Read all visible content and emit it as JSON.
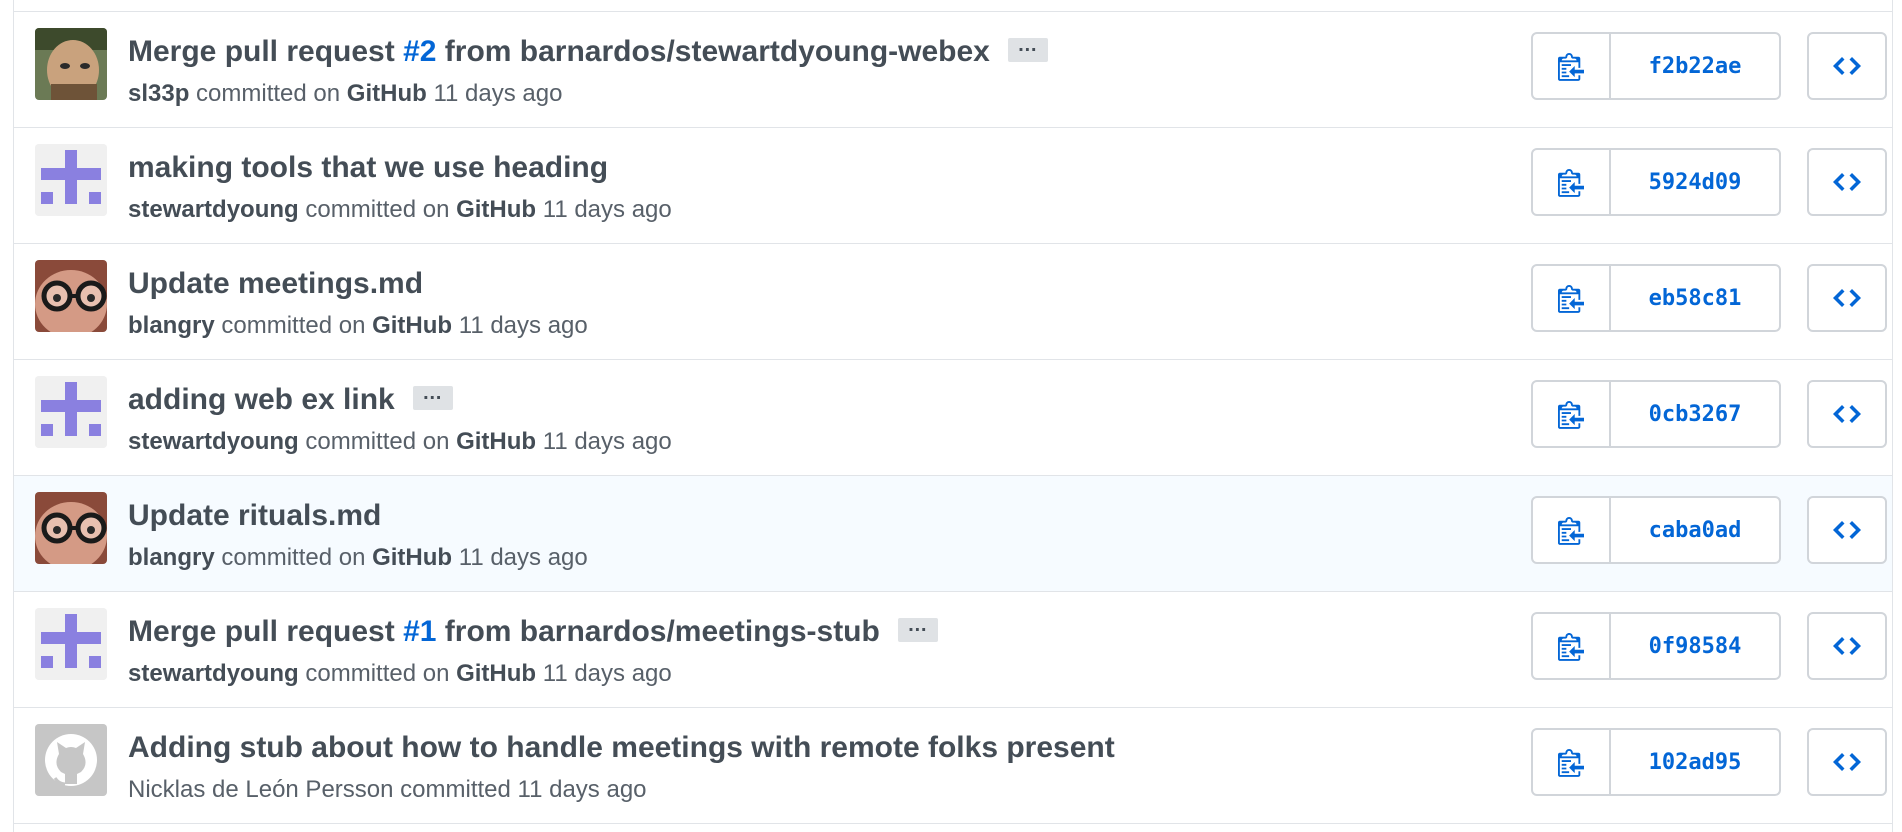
{
  "commits": [
    {
      "avatar": "photo-avatar-bearded-man",
      "title_prefix": "Merge pull request ",
      "pr_ref": "#2",
      "title_suffix": " from barnardos/stewartdyoung-webex",
      "has_ellipsis": true,
      "author": "sl33p",
      "committed_text": "committed on",
      "committer": "GitHub",
      "time": "11 days ago",
      "sha": "f2b22ae",
      "highlighted": false
    },
    {
      "avatar": "identicon-purple",
      "title_prefix": "making tools that we use heading",
      "pr_ref": "",
      "title_suffix": "",
      "has_ellipsis": false,
      "author": "stewartdyoung",
      "committed_text": "committed on",
      "committer": "GitHub",
      "time": "11 days ago",
      "sha": "5924d09",
      "highlighted": false
    },
    {
      "avatar": "photo-avatar-glasses",
      "title_prefix": "Update meetings.md",
      "pr_ref": "",
      "title_suffix": "",
      "has_ellipsis": false,
      "author": "blangry",
      "committed_text": "committed on",
      "committer": "GitHub",
      "time": "11 days ago",
      "sha": "eb58c81",
      "highlighted": false
    },
    {
      "avatar": "identicon-purple",
      "title_prefix": "adding web ex link",
      "pr_ref": "",
      "title_suffix": "",
      "has_ellipsis": true,
      "author": "stewartdyoung",
      "committed_text": "committed on",
      "committer": "GitHub",
      "time": "11 days ago",
      "sha": "0cb3267",
      "highlighted": false
    },
    {
      "avatar": "photo-avatar-glasses",
      "title_prefix": "Update rituals.md",
      "pr_ref": "",
      "title_suffix": "",
      "has_ellipsis": false,
      "author": "blangry",
      "committed_text": "committed on",
      "committer": "GitHub",
      "time": "11 days ago",
      "sha": "caba0ad",
      "highlighted": true
    },
    {
      "avatar": "identicon-purple",
      "title_prefix": "Merge pull request ",
      "pr_ref": "#1",
      "title_suffix": " from barnardos/meetings-stub",
      "has_ellipsis": true,
      "author": "stewartdyoung",
      "committed_text": "committed on",
      "committer": "GitHub",
      "time": "11 days ago",
      "sha": "0f98584",
      "highlighted": false
    },
    {
      "avatar": "octocat-default-avatar",
      "title_prefix": "Adding stub about how to handle meetings with remote folks present",
      "pr_ref": "",
      "title_suffix": "",
      "has_ellipsis": false,
      "author": "Nicklas de León Persson",
      "committed_text": "committed",
      "committer": "",
      "time": "11 days ago",
      "sha": "102ad95",
      "highlighted": false
    }
  ],
  "ellipsis_label": "…",
  "colors": {
    "link": "#0366d6",
    "text": "#444d56",
    "muted": "#586069",
    "border": "#e1e4e8",
    "identicon": "#8a80e0",
    "highlight_bg": "#f6fbff"
  }
}
